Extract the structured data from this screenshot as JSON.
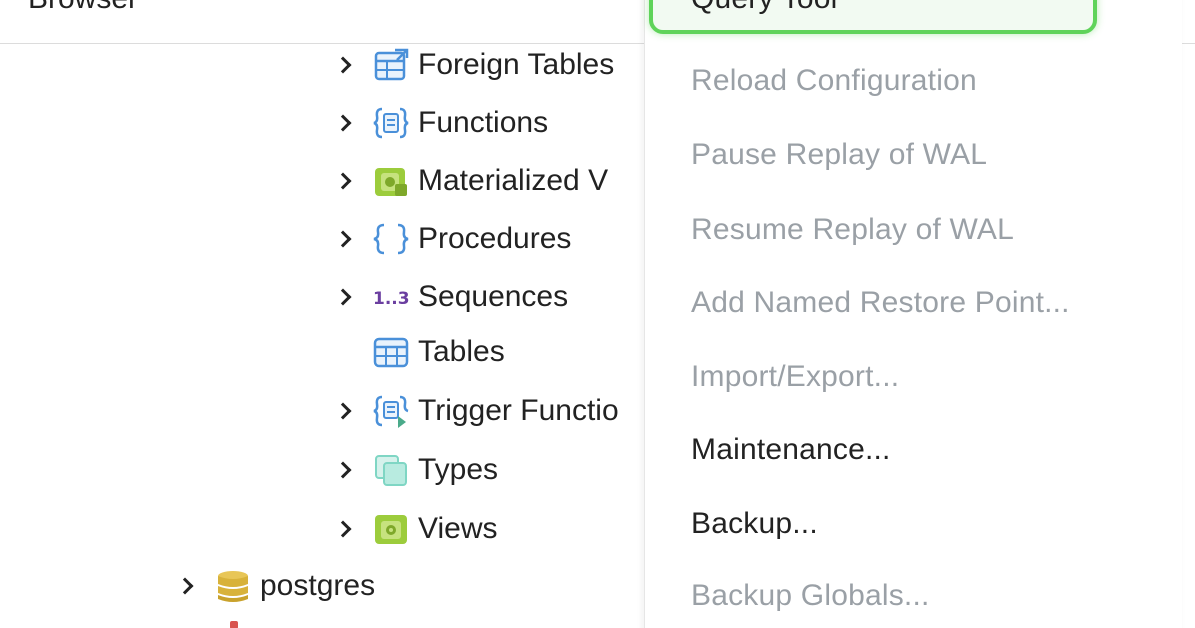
{
  "panel": {
    "title": "Browser"
  },
  "tree": {
    "items": [
      {
        "label": "Foreign Tables",
        "icon": "foreign-tables-icon",
        "expandable": true
      },
      {
        "label": "Functions",
        "icon": "functions-icon",
        "expandable": true
      },
      {
        "label": "Materialized V",
        "icon": "materialized-views-icon",
        "expandable": true
      },
      {
        "label": "Procedures",
        "icon": "procedures-icon",
        "expandable": true
      },
      {
        "label": "Sequences",
        "icon": "sequences-icon",
        "icon_text": "1..3",
        "expandable": true
      },
      {
        "label": "Tables",
        "icon": "tables-icon",
        "expandable": false
      },
      {
        "label": "Trigger Functio",
        "icon": "trigger-functions-icon",
        "expandable": true
      },
      {
        "label": "Types",
        "icon": "types-icon",
        "expandable": true
      },
      {
        "label": "Views",
        "icon": "views-icon",
        "expandable": true
      }
    ],
    "database": {
      "label": "postgres",
      "icon": "database-icon",
      "expandable": true
    }
  },
  "menu": {
    "items": [
      {
        "label": "Query Tool",
        "enabled": true,
        "highlighted": true
      },
      {
        "label": "Reload Configuration",
        "enabled": false
      },
      {
        "label": "Pause Replay of WAL",
        "enabled": false
      },
      {
        "label": "Resume Replay of WAL",
        "enabled": false
      },
      {
        "label": "Add Named Restore Point...",
        "enabled": false
      },
      {
        "label": "Import/Export...",
        "enabled": false
      },
      {
        "label": "Maintenance...",
        "enabled": true
      },
      {
        "label": "Backup...",
        "enabled": true
      },
      {
        "label": "Backup Globals...",
        "enabled": false
      }
    ]
  },
  "colors": {
    "highlight_border": "#5fd35a",
    "disabled_text": "#9aa0a6",
    "icon_blue": "#4a90d9",
    "icon_green": "#9ccc3c",
    "icon_teal": "#7fd6c4",
    "icon_purple": "#6b3fa0",
    "database_gold": "#d8b23a"
  }
}
